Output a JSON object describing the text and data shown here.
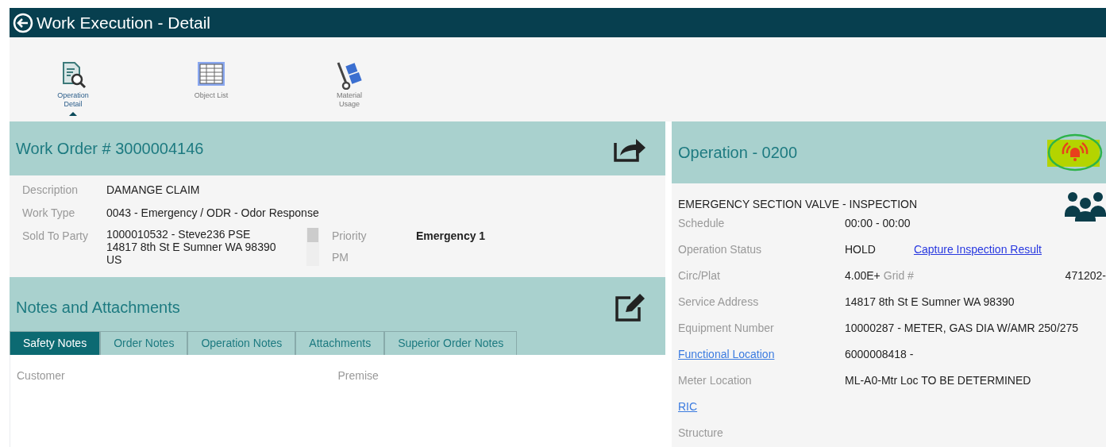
{
  "window": {
    "title": "Work Execution - Detail"
  },
  "toolbar": [
    {
      "label": "Operation Detail",
      "selected": true,
      "kind": "document-search"
    },
    {
      "label": "Object List",
      "selected": false,
      "kind": "table"
    },
    {
      "label": "Material Usage",
      "selected": false,
      "kind": "hand-truck"
    }
  ],
  "work_order": {
    "title": "Work Order # 3000004146",
    "fields": [
      {
        "label": "Description",
        "value": "DAMANGE CLAIM"
      },
      {
        "label": "Work Type",
        "value": "0043 - Emergency / ODR - Odor Response"
      }
    ],
    "sold_to_party": {
      "label": "Sold To Party",
      "lines": [
        "1000010532 - Steve236 PSE",
        "14817 8th St E  Sumner WA 98390",
        "US"
      ]
    },
    "side_fields": [
      {
        "label": "Priority",
        "value": "Emergency 1"
      },
      {
        "label": "PM"
      }
    ]
  },
  "notes": {
    "title": "Notes and Attachments",
    "tabs": [
      {
        "label": "Safety Notes",
        "selected": true
      },
      {
        "label": "Order Notes",
        "selected": false
      },
      {
        "label": "Operation Notes",
        "selected": false
      },
      {
        "label": "Attachments",
        "selected": false
      },
      {
        "label": "Superior Order Notes",
        "selected": false
      }
    ],
    "columns": [
      "Customer",
      "Premise"
    ]
  },
  "operation": {
    "title": "Operation - 0200",
    "description": "EMERGENCY SECTION VALVE - INSPECTION",
    "fields": [
      {
        "label": "Schedule",
        "value": "00:00 -  00:00",
        "label_link": false
      },
      {
        "label": "Operation Status",
        "value": "HOLD",
        "action_link": "Capture Inspection Result",
        "label_link": false
      },
      {
        "label": "Circ/Plat",
        "value": "4.00E+",
        "extra_label": "Grid #",
        "extra_value": "471202-",
        "label_link": false
      },
      {
        "label": "Service Address",
        "value": "14817 8th St E  Sumner WA 98390",
        "label_link": false
      },
      {
        "label": "Equipment Number",
        "value": "10000287 - METER, GAS DIA W/AMR 250/275",
        "label_link": false
      },
      {
        "label": "Functional Location",
        "value": "6000008418 -",
        "label_link": true
      },
      {
        "label": "Meter Location",
        "value": "ML-A0-Mtr Loc TO BE DETERMINED",
        "label_link": false
      },
      {
        "label": "RIC",
        "label_link": true
      },
      {
        "label": "Structure",
        "label_link": false
      }
    ]
  }
}
